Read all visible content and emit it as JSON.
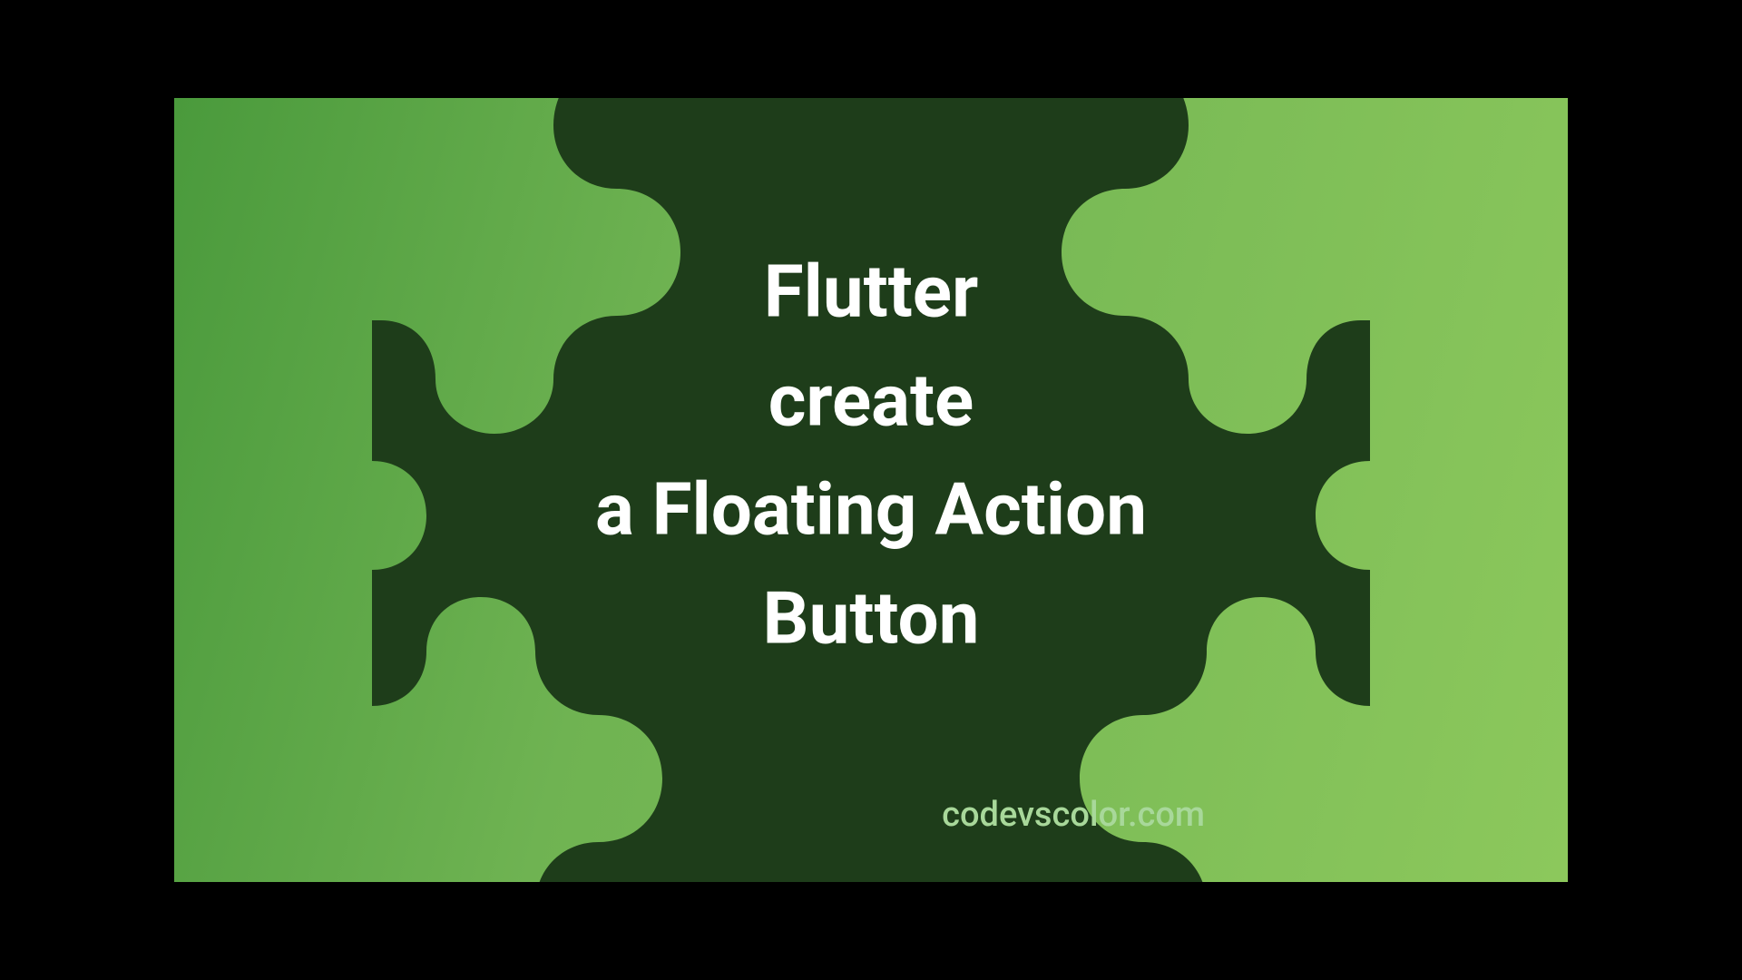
{
  "title": {
    "line1": "Flutter",
    "line2": "create",
    "line3": "a Floating Action",
    "line4": "Button"
  },
  "attribution": "codevscolor.com",
  "colors": {
    "gradientStart": "#4a9a3c",
    "gradientEnd": "#8cc85c",
    "blobFill": "#1e3d1a",
    "titleText": "#ffffff",
    "attributionText": "#a8d89a"
  }
}
